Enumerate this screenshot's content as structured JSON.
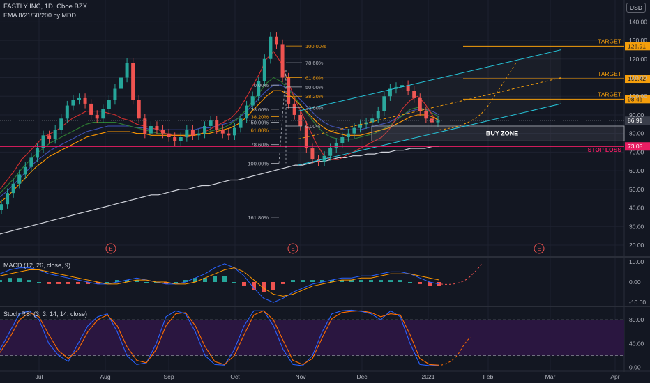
{
  "header": {
    "title": "FASTLY INC, 1D, Cboe BZX",
    "indicator": "EMA 8/21/50/200 by MDD",
    "currency": "USD"
  },
  "colors": {
    "background": "#131722",
    "grid": "#1e2230",
    "axis_text": "#b2b5be",
    "candle_up": "#26a69a",
    "candle_down": "#ef5350",
    "ema8": "#d32f2f",
    "ema21": "#2e7d32",
    "ema50": "#3f51b5",
    "ema50b": "#ff9800",
    "ema200": "#d1d4dc",
    "channel": "#26c6da",
    "fib": "#f59e0b",
    "target": "#f59e0b",
    "stop": "#e91e63",
    "macd_line": "#2962ff",
    "signal_line": "#ff9800",
    "rsi_fill": "#2a1640",
    "rsi_k": "#2962ff",
    "rsi_d": "#ff6d00"
  },
  "chart_data": [
    {
      "type": "candlestick",
      "title": "FASTLY INC, 1D, Cboe BZX",
      "x_ticks": [
        "Jul",
        "Aug",
        "Sep",
        "Oct",
        "Nov",
        "Dec",
        "2021",
        "Feb",
        "Mar",
        "Apr"
      ],
      "y_ticks": [
        20,
        30,
        40,
        50,
        60,
        70,
        80,
        90,
        100,
        110,
        120,
        130,
        140
      ],
      "ylim": [
        14,
        145
      ],
      "series": [
        {
          "name": "EMA 8",
          "values": [
            50,
            55,
            60,
            66,
            70,
            74,
            78,
            80,
            82,
            85,
            88,
            90,
            92,
            92,
            92,
            91,
            90,
            88,
            87,
            85,
            84,
            83,
            82,
            80,
            79,
            79,
            78,
            79,
            80,
            82,
            84,
            86,
            88,
            92,
            98,
            105,
            112,
            120,
            124,
            118,
            108,
            98,
            90,
            82,
            74,
            68,
            66,
            66,
            68,
            70,
            72,
            74,
            76,
            78,
            82,
            88,
            94,
            98,
            100,
            96,
            90,
            86
          ]
        },
        {
          "name": "EMA 21",
          "values": [
            48,
            52,
            56,
            61,
            65,
            69,
            72,
            75,
            77,
            79,
            81,
            83,
            85,
            86,
            86,
            86,
            86,
            85,
            84,
            83,
            82,
            81,
            80,
            80,
            79,
            79,
            79,
            79,
            80,
            81,
            82,
            83,
            85,
            88,
            92,
            97,
            102,
            107,
            110,
            108,
            104,
            99,
            94,
            89,
            84,
            80,
            78,
            77,
            77,
            77,
            78,
            79,
            80,
            82,
            84,
            87,
            90,
            93,
            94,
            93,
            91,
            89
          ]
        },
        {
          "name": "EMA 50",
          "values": [
            46,
            49,
            53,
            57,
            61,
            65,
            68,
            71,
            73,
            75,
            77,
            79,
            81,
            82,
            83,
            84,
            84,
            84,
            84,
            83,
            83,
            82,
            82,
            82,
            82,
            82,
            82,
            82,
            83,
            83,
            84,
            85,
            86,
            88,
            91,
            95,
            99,
            103,
            106,
            106,
            104,
            101,
            97,
            93,
            89,
            86,
            84,
            83,
            82,
            82,
            82,
            83,
            84,
            85,
            86,
            88,
            90,
            92,
            93,
            93,
            92,
            90
          ]
        },
        {
          "name": "EMA 200",
          "values": [
            26,
            27,
            28,
            29,
            30,
            31,
            32,
            33,
            34,
            35,
            36,
            37,
            38,
            39,
            40,
            41,
            42,
            43,
            44,
            45,
            46,
            47,
            47,
            48,
            49,
            50,
            50,
            51,
            52,
            52,
            53,
            54,
            55,
            55,
            56,
            57,
            58,
            59,
            60,
            61,
            62,
            63,
            63,
            64,
            65,
            65,
            66,
            67,
            67,
            68,
            68,
            69,
            69,
            70,
            70,
            71,
            71,
            72,
            72,
            72,
            73,
            73
          ]
        }
      ],
      "candles_close": [
        42,
        48,
        53,
        58,
        62,
        67,
        72,
        79,
        77,
        82,
        88,
        95,
        98,
        99,
        96,
        90,
        88,
        93,
        98,
        104,
        110,
        118,
        98,
        88,
        80,
        84,
        82,
        80,
        78,
        76,
        78,
        82,
        79,
        80,
        84,
        87,
        82,
        80,
        79,
        83,
        88,
        95,
        100,
        108,
        120,
        132,
        128,
        110,
        96,
        90,
        84,
        72,
        66,
        65,
        68,
        72,
        75,
        78,
        80,
        83,
        85,
        86,
        88,
        92,
        100,
        104,
        105,
        106,
        103,
        99,
        92,
        88,
        86,
        86.91
      ],
      "last_price": "86.91",
      "fibonacci_1": [
        {
          "level": "0.00%",
          "price": 106
        },
        {
          "level": "23.60%",
          "price": 93
        },
        {
          "level": "38.20%",
          "price": 89
        },
        {
          "level": "50.00%",
          "price": 86
        },
        {
          "level": "61.80%",
          "price": 82
        },
        {
          "level": "78.60%",
          "price": 74
        },
        {
          "level": "100.00%",
          "price": 64
        },
        {
          "level": "161.80%",
          "price": 35
        }
      ],
      "fibonacci_2": [
        {
          "level": "100.00%",
          "price": 127
        },
        {
          "level": "78.60%",
          "price": 118
        },
        {
          "level": "61.80%",
          "price": 110
        },
        {
          "level": "50.00%",
          "price": 105
        },
        {
          "level": "38.20%",
          "price": 100
        },
        {
          "level": "23.60%",
          "price": 94
        },
        {
          "level": "0.00%",
          "price": 84
        }
      ],
      "targets": [
        {
          "label": "TARGET",
          "price": "126.91",
          "value": 126.91
        },
        {
          "label": "TARGET",
          "price": "109.42",
          "value": 109.42
        },
        {
          "label": "TARGET",
          "price": "98.46",
          "value": 98.46
        }
      ],
      "stop_loss": {
        "label": "STOP LOSS",
        "price": "73.05",
        "value": 73.05
      },
      "buy_zone": {
        "label": "BUY ZONE",
        "from": 76,
        "to": 84
      },
      "earnings_marker": "E"
    },
    {
      "type": "line",
      "title": "MACD (12, 26, close, 9)",
      "y_ticks": [
        10.0,
        0.0,
        -10.0
      ],
      "ylim": [
        -12,
        12
      ],
      "series": [
        {
          "name": "MACD",
          "values": [
            4,
            6,
            7,
            7,
            6,
            4,
            3,
            2,
            1,
            0,
            -1,
            -1,
            0,
            1,
            2,
            1,
            0,
            -1,
            -1,
            0,
            2,
            4,
            7,
            9,
            7,
            3,
            -3,
            -8,
            -10,
            -8,
            -5,
            -3,
            -1,
            0,
            1,
            2,
            2,
            3,
            3,
            4,
            5,
            5,
            4,
            2,
            0,
            -1
          ]
        },
        {
          "name": "Signal",
          "values": [
            3,
            4,
            5,
            6,
            6,
            5,
            4,
            3,
            2,
            1,
            0,
            -1,
            -1,
            0,
            1,
            1,
            0,
            0,
            -1,
            -1,
            0,
            2,
            4,
            6,
            7,
            5,
            1,
            -3,
            -6,
            -7,
            -6,
            -4,
            -2,
            -1,
            0,
            1,
            1,
            2,
            2,
            3,
            4,
            4,
            4,
            3,
            2,
            1
          ]
        }
      ]
    },
    {
      "type": "line",
      "title": "Stoch RSI (3, 3, 14, 14, close)",
      "y_ticks": [
        80.0,
        40.0,
        0.0
      ],
      "ylim": [
        -5,
        100
      ],
      "series": [
        {
          "name": "K",
          "values": [
            30,
            60,
            90,
            95,
            80,
            40,
            20,
            10,
            40,
            70,
            85,
            90,
            60,
            20,
            5,
            8,
            40,
            85,
            95,
            90,
            60,
            20,
            5,
            4,
            30,
            70,
            95,
            95,
            70,
            30,
            5,
            3,
            20,
            60,
            90,
            95,
            96,
            94,
            90,
            80,
            95,
            85,
            40,
            5,
            3,
            4
          ]
        },
        {
          "name": "D",
          "values": [
            25,
            50,
            80,
            92,
            85,
            55,
            28,
            15,
            30,
            60,
            80,
            88,
            70,
            35,
            12,
            8,
            30,
            70,
            90,
            92,
            70,
            35,
            10,
            5,
            20,
            55,
            88,
            95,
            80,
            45,
            12,
            5,
            15,
            50,
            82,
            92,
            94,
            95,
            92,
            85,
            90,
            88,
            55,
            15,
            5,
            4
          ]
        }
      ]
    }
  ]
}
